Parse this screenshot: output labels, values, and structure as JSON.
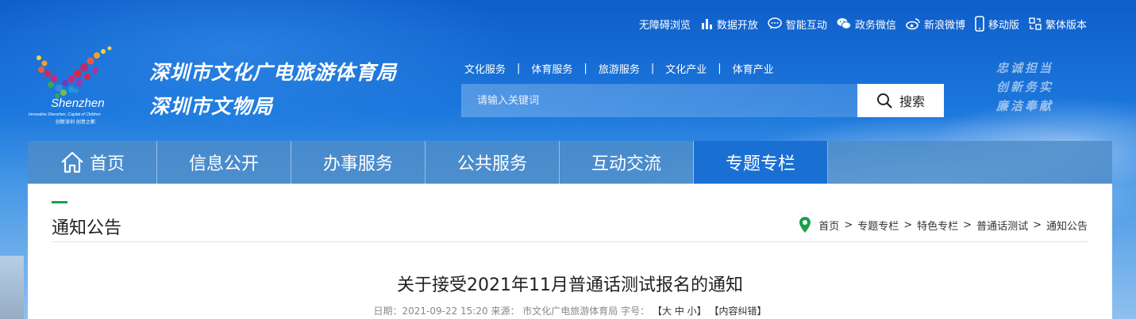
{
  "top_links": [
    {
      "label": "无障碍浏览",
      "icon": ""
    },
    {
      "label": "数据开放",
      "icon": "bar-chart-icon"
    },
    {
      "label": "智能互动",
      "icon": "chat-bubble-icon"
    },
    {
      "label": "政务微信",
      "icon": "wechat-icon"
    },
    {
      "label": "新浪微博",
      "icon": "weibo-icon"
    },
    {
      "label": "移动版",
      "icon": "mobile-icon"
    },
    {
      "label": "繁体版本",
      "icon": "traditional-icon"
    }
  ],
  "logo": {
    "line1": "深圳市文化广电旅游体育局",
    "line2": "深圳市文物局",
    "mark_word": "Shenzhen",
    "mark_sub": "Innovative Shenzhen, Capital of Children",
    "mark_cn": "创新深圳 创意之都"
  },
  "category_nav": [
    "文化服务",
    "体育服务",
    "旅游服务",
    "文化产业",
    "体育产业"
  ],
  "category_sep": "|",
  "search": {
    "placeholder": "请输入关键词",
    "button": "搜索"
  },
  "slogan": [
    "忠诚担当",
    "创新务实",
    "廉洁奉献"
  ],
  "main_nav": [
    {
      "label": "首页",
      "active": false
    },
    {
      "label": "信息公开",
      "active": false
    },
    {
      "label": "办事服务",
      "active": false
    },
    {
      "label": "公共服务",
      "active": false
    },
    {
      "label": "互动交流",
      "active": false
    },
    {
      "label": "专题专栏",
      "active": true
    }
  ],
  "section_title": "通知公告",
  "breadcrumb": [
    "首页",
    "专题专栏",
    "特色专栏",
    "普通话测试",
    "通知公告"
  ],
  "breadcrumb_sep": ">",
  "article": {
    "title": "关于接受2021年11月普通话测试报名的通知",
    "date_label": "日期：",
    "date": "2021-09-22 15:20",
    "source_label": "来源：",
    "source": "市文化广电旅游体育局",
    "fontsize_label": "字号：",
    "fontsize_open": "【",
    "fontsize_large": "大",
    "fontsize_medium": "中",
    "fontsize_small": "小",
    "fontsize_close": "】",
    "correction": "【内容纠错】"
  },
  "colors": {
    "nav_active": "#1a6fd3",
    "accent_green": "#1aa04a",
    "pin_green": "#1aa04a"
  }
}
